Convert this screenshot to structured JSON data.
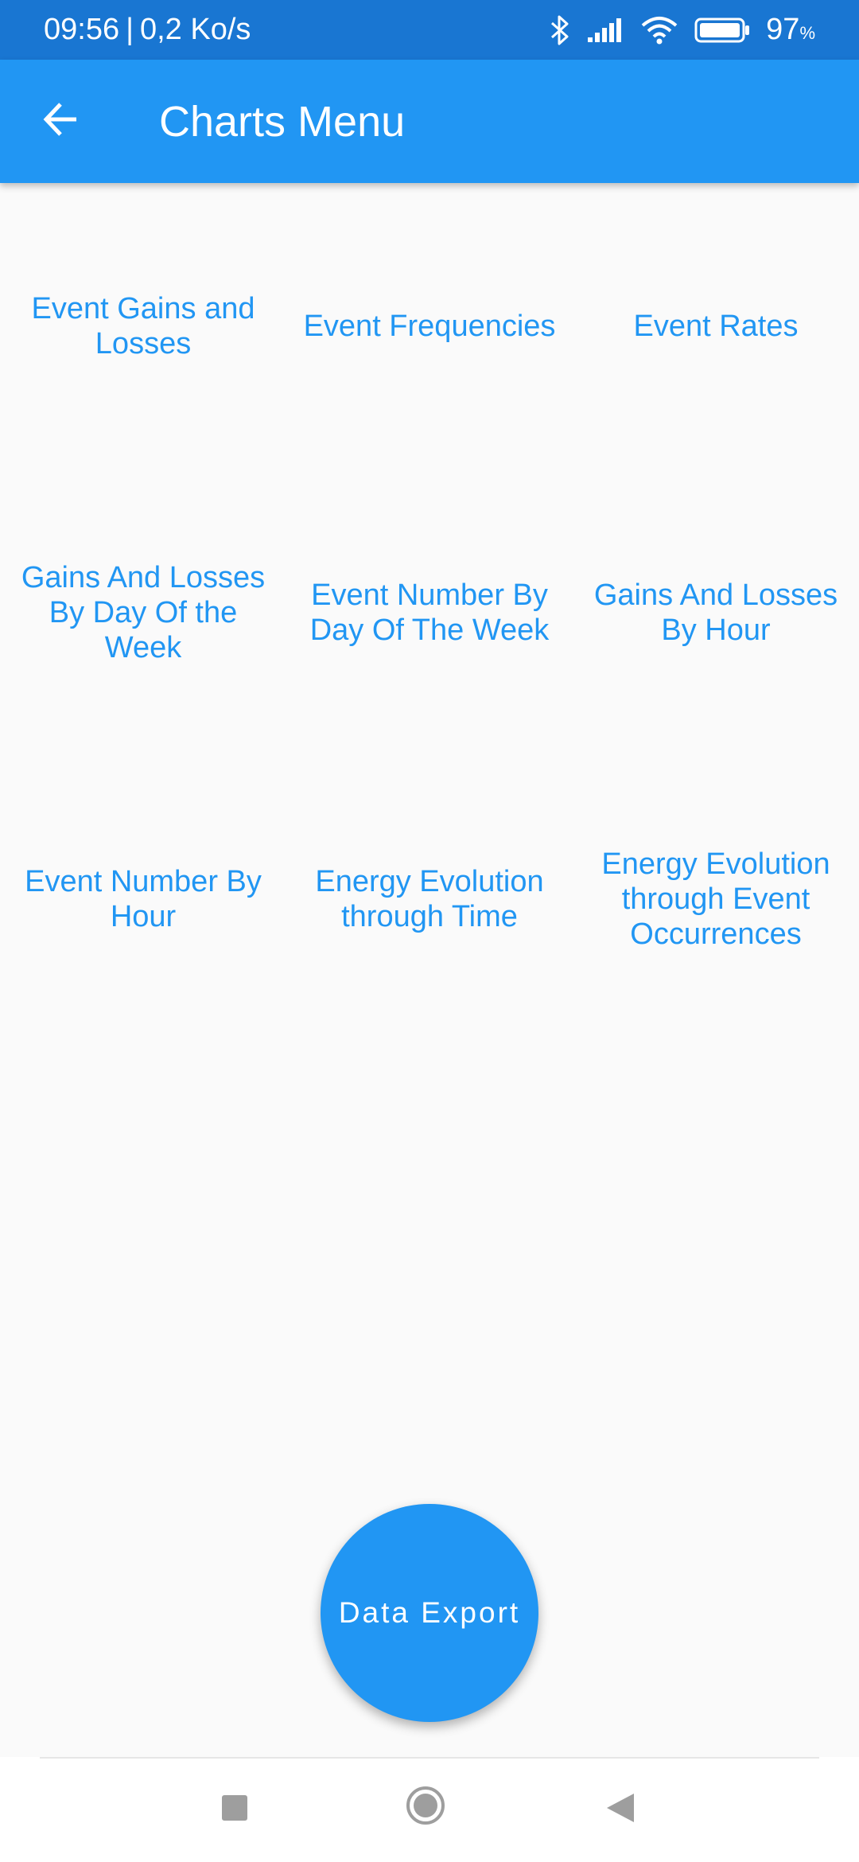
{
  "status_bar": {
    "time": "09:56",
    "separator": "|",
    "speed": "0,2 Ko/s",
    "battery_level": "97",
    "battery_unit": "%"
  },
  "app_bar": {
    "title": "Charts Menu",
    "back_icon": "arrow-back-icon"
  },
  "menu": {
    "items": [
      {
        "label": "Event Gains and Losses"
      },
      {
        "label": "Event Frequencies"
      },
      {
        "label": "Event Rates"
      },
      {
        "label": "Gains And Losses By Day Of the Week"
      },
      {
        "label": "Event Number By Day Of The Week"
      },
      {
        "label": "Gains And Losses By Hour"
      },
      {
        "label": "Event Number By Hour"
      },
      {
        "label": "Energy Evolution through Time"
      },
      {
        "label": "Energy Evolution through Event Occurrences"
      }
    ]
  },
  "fab": {
    "label": "Data Export"
  },
  "nav_bar": {
    "recents_icon": "square-icon",
    "home_icon": "circle-icon",
    "back_icon": "triangle-back-icon"
  },
  "colors": {
    "status_bar": "#1976d2",
    "primary": "#2196f3",
    "background": "#fafafa"
  }
}
